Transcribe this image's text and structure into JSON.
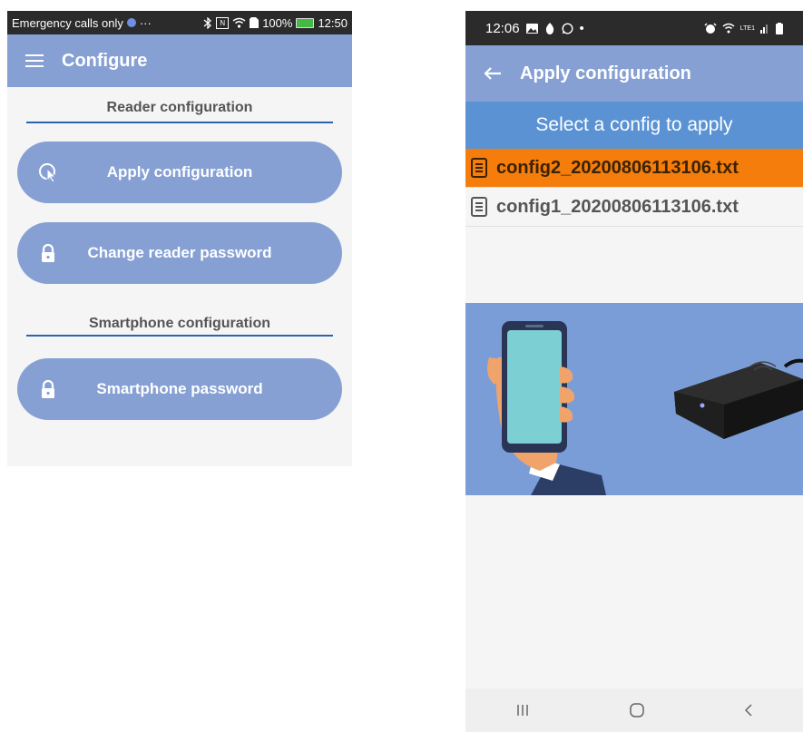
{
  "left_screen": {
    "status_bar": {
      "carrier": "Emergency calls only",
      "dots": "···",
      "nfc": "N",
      "battery": "100%",
      "time": "12:50"
    },
    "app_bar": {
      "title": "Configure"
    },
    "reader_section": {
      "title": "Reader configuration"
    },
    "apply_button": {
      "label": "Apply configuration"
    },
    "reader_password_button": {
      "label": "Change reader password"
    },
    "smartphone_section": {
      "title": "Smartphone configuration"
    },
    "smartphone_password_button": {
      "label": "Smartphone password"
    }
  },
  "right_screen": {
    "status_bar": {
      "time": "12:06",
      "dot": "•",
      "lte": "LTE1"
    },
    "app_bar": {
      "title": "Apply configuration"
    },
    "select_header": "Select a config to apply",
    "configs": [
      {
        "name": "config2_20200806113106.txt",
        "selected": true
      },
      {
        "name": "config1_20200806113106.txt",
        "selected": false
      }
    ]
  },
  "colors": {
    "app_bar": "#86a0d4",
    "accent_blue": "#5a92d4",
    "selected_orange": "#f57d0c",
    "section_line": "#2a64b0",
    "illustration_bg": "#7a9dd8"
  }
}
